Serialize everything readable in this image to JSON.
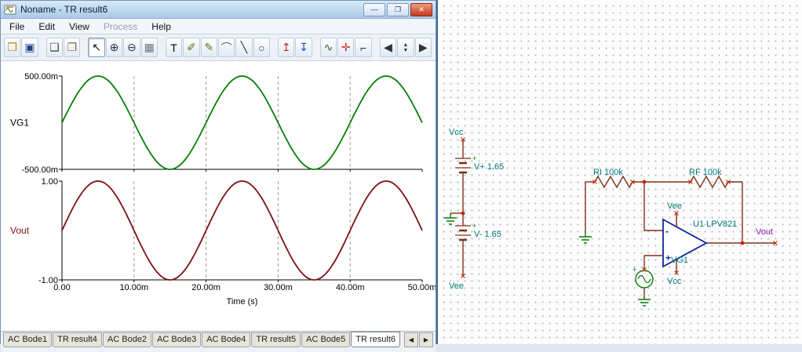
{
  "window": {
    "title": "Noname - TR result6",
    "controls": [
      {
        "name": "minimize-button",
        "glyph": "—"
      },
      {
        "name": "restore-button",
        "glyph": "❐"
      },
      {
        "name": "close-button",
        "glyph": "✕"
      }
    ],
    "menu": [
      {
        "label": "File",
        "enabled": true
      },
      {
        "label": "Edit",
        "enabled": true
      },
      {
        "label": "View",
        "enabled": true
      },
      {
        "label": "Process",
        "enabled": false
      },
      {
        "label": "Help",
        "enabled": true
      }
    ]
  },
  "toolbar": {
    "icons": [
      {
        "name": "open-icon",
        "glyph": "❒",
        "color": "#b8860b"
      },
      {
        "name": "save-icon",
        "glyph": "▣",
        "color": "#27408b"
      },
      {
        "name": "copy-icon",
        "glyph": "❏",
        "color": "#444444",
        "gap": true
      },
      {
        "name": "paste-icon",
        "glyph": "❐",
        "color": "#8a6d3b"
      },
      {
        "name": "cursor-icon",
        "glyph": "↖",
        "color": "#111111",
        "gap": true,
        "selected": true
      },
      {
        "name": "zoom-in-icon",
        "glyph": "⊕",
        "color": "#223355"
      },
      {
        "name": "zoom-100-icon",
        "glyph": "⊖",
        "color": "#223355"
      },
      {
        "name": "grid-icon",
        "glyph": "▦",
        "color": "#667788"
      },
      {
        "name": "text-icon",
        "glyph": "T",
        "color": "#000000",
        "gap": true
      },
      {
        "name": "probe-icon",
        "glyph": "✐",
        "color": "#6b6b20"
      },
      {
        "name": "signal-probe-icon",
        "glyph": "✎",
        "color": "#6b6b20"
      },
      {
        "name": "meter-icon",
        "glyph": "⌒",
        "color": "#555555"
      },
      {
        "name": "line-icon",
        "glyph": "╲",
        "color": "#333333"
      },
      {
        "name": "ellipse-icon",
        "glyph": "○",
        "color": "#333333"
      },
      {
        "name": "voltage-pin-icon",
        "glyph": "↥",
        "color": "#cc2222",
        "gap": true
      },
      {
        "name": "current-pin-icon",
        "glyph": "↧",
        "color": "#2244cc"
      },
      {
        "name": "waveform-icon",
        "glyph": "∿",
        "color": "#226622",
        "gap": true
      },
      {
        "name": "add-pin-icon",
        "glyph": "✛",
        "color": "#cc2222"
      },
      {
        "name": "corner-icon",
        "glyph": "⌐",
        "color": "#333333"
      },
      {
        "name": "tool-prev-icon",
        "glyph": "◀",
        "color": "#333333",
        "gap": true
      },
      {
        "name": "spinner-icon",
        "glyph_up": "▲",
        "glyph_down": "▼",
        "color": "#333333"
      },
      {
        "name": "tool-next-icon",
        "glyph": "▶",
        "color": "#333333"
      }
    ]
  },
  "chart": {
    "xlabel": "Time (s)",
    "x_ticks": [
      "0.00",
      "10.00m",
      "20.00m",
      "30.00m",
      "40.00m",
      "50.00m"
    ],
    "x_tick_s": [
      0,
      0.01,
      0.02,
      0.03,
      0.04,
      0.05
    ],
    "grid_x_s": [
      0.01,
      0.02,
      0.03,
      0.04
    ],
    "grid_style": "dashed-vertical"
  },
  "chart_data": [
    {
      "type": "line",
      "name": "VG1",
      "color": "#067f06",
      "label_color": "#000000",
      "ylim": [
        -0.5,
        0.5
      ],
      "y_tick_labels": {
        "top": "500.00m",
        "bottom": "-500.00m"
      },
      "x_range_s": [
        0,
        0.05
      ],
      "signal": {
        "shape": "sine",
        "amplitude": 0.5,
        "frequency_hz": 50,
        "phase_deg": 0,
        "offset": 0
      }
    },
    {
      "type": "line",
      "name": "Vout",
      "color": "#7c1113",
      "label_color": "#7c1113",
      "ylim": [
        -1.0,
        1.0
      ],
      "y_tick_labels": {
        "top": "1.00",
        "bottom": "-1.00"
      },
      "x_range_s": [
        0,
        0.05
      ],
      "signal": {
        "shape": "sine",
        "amplitude": 1.0,
        "frequency_hz": 50,
        "phase_deg": 0,
        "offset": 0
      }
    }
  ],
  "tabs": {
    "items": [
      {
        "label": "AC Bode1",
        "active": false
      },
      {
        "label": "TR result4",
        "active": false
      },
      {
        "label": "AC Bode2",
        "active": false
      },
      {
        "label": "AC Bode3",
        "active": false
      },
      {
        "label": "AC Bode4",
        "active": false
      },
      {
        "label": "TR result5",
        "active": false
      },
      {
        "label": "AC Bode5",
        "active": false
      },
      {
        "label": "TR result6",
        "active": true
      }
    ],
    "scroll_left_glyph": "◀",
    "scroll_right_glyph": "▶"
  },
  "schematic": {
    "labels": {
      "vcc_top": "Vcc",
      "vplus": "V+ 1.65",
      "vminus": "V- 1.65",
      "vee_bottom": "Vee",
      "ri": "RI 100k",
      "rf": "RF 100k",
      "u1": "U1 LPV821",
      "opamp_vee": "Vee",
      "opamp_vcc": "Vcc",
      "opamp_minus": "-",
      "opamp_plus": "+",
      "vg1": "VG1",
      "vout": "Vout",
      "polarity_plus": "+"
    },
    "colors": {
      "wire": "#803018",
      "ground": "#0a7a0a",
      "label": "#007878",
      "opamp": "#1126a0",
      "vout_label": "#9518a8",
      "junction": "#cc2200"
    }
  }
}
